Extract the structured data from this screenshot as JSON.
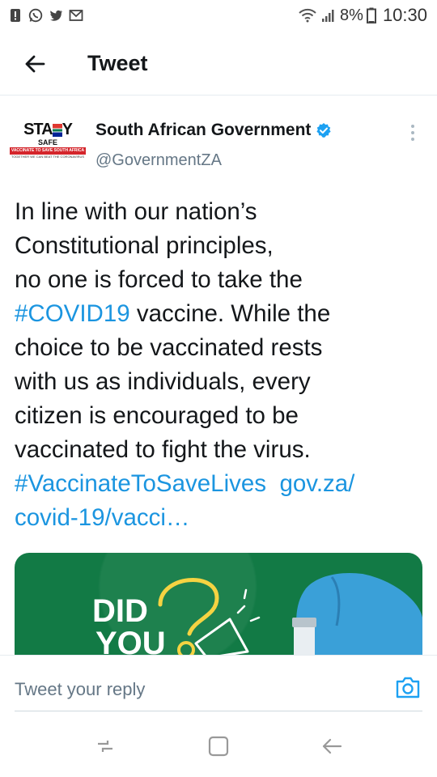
{
  "status_bar": {
    "battery_percent": "8%",
    "time": "10:30",
    "icons": [
      "notification-icon",
      "whatsapp-icon",
      "twitter-icon",
      "gmail-icon",
      "wifi-icon",
      "signal-icon",
      "battery-icon"
    ]
  },
  "header": {
    "title": "Tweet",
    "back_icon": "arrow-left-icon"
  },
  "tweet": {
    "author_name": "South African Government",
    "author_handle": "@GovernmentZA",
    "verified": true,
    "avatar": {
      "logo_text_a": "STA",
      "logo_text_b": "Y",
      "safe": "SAFE",
      "banner": "VACCINATE TO SAVE SOUTH AFRICA",
      "tagline": "TOGETHER WE CAN BEAT THE CORONAVIRUS"
    },
    "text_lines": {
      "l1": "In line with our nation’s",
      "l2": "Constitutional principles,",
      "l3": "no one is forced to take the",
      "l4_link": "#COVID19",
      "l4_rest": " vaccine. While the",
      "l5": "choice to be vaccinated rests",
      "l6": "with us as individuals, every",
      "l7": "citizen is encouraged to be",
      "l8": "vaccinated to fight the virus.",
      "l9_hashtag": "#VaccinateToSaveLives",
      "l9_url": "gov.za/",
      "l10_url": "covid-19/vacci…"
    },
    "media": {
      "line1": "DID",
      "line2": "YOU",
      "accent_color": "#127a45"
    }
  },
  "reply": {
    "placeholder": "Tweet your reply",
    "camera_icon": "camera-icon"
  },
  "nav": {
    "icons": [
      "recents-icon",
      "home-icon",
      "back-icon"
    ]
  },
  "colors": {
    "link": "#1b95e0",
    "verified": "#1da1f2",
    "text": "#14171a",
    "secondary": "#657786"
  }
}
